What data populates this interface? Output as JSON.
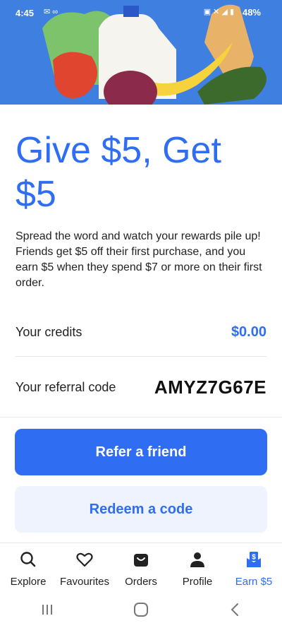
{
  "status_bar": {
    "time": "4:45",
    "battery": "48%"
  },
  "hero": {
    "alt_icons": [
      "vegetables-illustration",
      "milk-jug",
      "bread",
      "banana",
      "onion",
      "pepper",
      "cucumber"
    ]
  },
  "headline": "Give $5, Get $5",
  "description": "Spread the word and watch your rewards pile up! Friends get $5 off their first purchase, and you earn $5 when they spend $7 or more on their first order.",
  "credits": {
    "label": "Your credits",
    "value": "$0.00"
  },
  "referral": {
    "label": "Your referral code",
    "code": "AMYZ7G67E"
  },
  "buttons": {
    "refer": "Refer a friend",
    "redeem": "Redeem a code"
  },
  "nav": {
    "items": [
      {
        "label": "Explore",
        "icon": "search-icon"
      },
      {
        "label": "Favourites",
        "icon": "heart-icon"
      },
      {
        "label": "Orders",
        "icon": "bag-icon"
      },
      {
        "label": "Profile",
        "icon": "person-icon"
      },
      {
        "label": "Earn $5",
        "icon": "gift-dollar-icon",
        "active": true
      }
    ]
  },
  "colors": {
    "accent": "#2f6ef3",
    "hero_bg": "#3f7fe0",
    "secondary_btn_bg": "#eef3fd"
  }
}
